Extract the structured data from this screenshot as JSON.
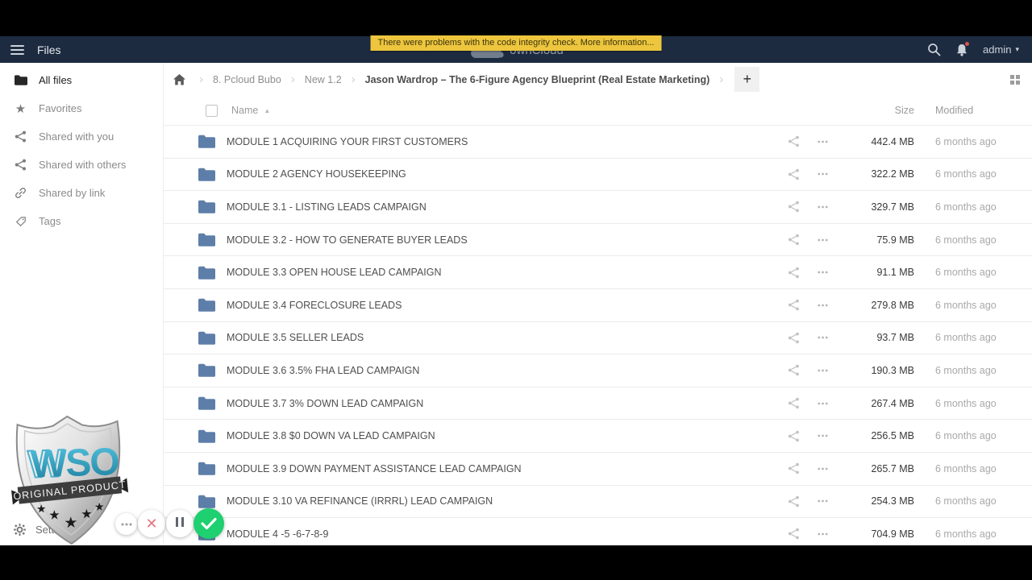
{
  "topbar": {
    "app_label": "Files",
    "logo_text": "ownCloud",
    "banner_text": "There were problems with the code integrity check. More information...",
    "user_label": "admin"
  },
  "sidebar": {
    "items": [
      {
        "label": "All files",
        "icon": "folder-icon",
        "active": true
      },
      {
        "label": "Favorites",
        "icon": "star-icon",
        "active": false
      },
      {
        "label": "Shared with you",
        "icon": "share-icon",
        "active": false
      },
      {
        "label": "Shared with others",
        "icon": "share-icon",
        "active": false
      },
      {
        "label": "Shared by link",
        "icon": "link-icon",
        "active": false
      },
      {
        "label": "Tags",
        "icon": "tag-icon",
        "active": false
      }
    ],
    "settings_label": "Settings"
  },
  "breadcrumb": {
    "crumbs": [
      "8. Pcloud Bubo",
      "New 1.2",
      "Jason Wardrop – The 6-Figure Agency Blueprint (Real Estate Marketing)"
    ],
    "add_button_label": "+"
  },
  "table": {
    "headers": {
      "name": "Name",
      "size": "Size",
      "modified": "Modified"
    },
    "rows": [
      {
        "name": "MODULE 1 ACQUIRING YOUR FIRST CUSTOMERS",
        "size": "442.4 MB",
        "modified": "6 months ago"
      },
      {
        "name": "MODULE 2 AGENCY HOUSEKEEPING",
        "size": "322.2 MB",
        "modified": "6 months ago"
      },
      {
        "name": "MODULE 3.1 - LISTING LEADS CAMPAIGN",
        "size": "329.7 MB",
        "modified": "6 months ago"
      },
      {
        "name": "MODULE 3.2 - HOW TO GENERATE BUYER LEADS",
        "size": "75.9 MB",
        "modified": "6 months ago"
      },
      {
        "name": "MODULE 3.3 OPEN HOUSE LEAD CAMPAIGN",
        "size": "91.1 MB",
        "modified": "6 months ago"
      },
      {
        "name": "MODULE 3.4 FORECLOSURE LEADS",
        "size": "279.8 MB",
        "modified": "6 months ago"
      },
      {
        "name": "MODULE 3.5 SELLER LEADS",
        "size": "93.7 MB",
        "modified": "6 months ago"
      },
      {
        "name": "MODULE 3.6 3.5% FHA LEAD CAMPAIGN",
        "size": "190.3 MB",
        "modified": "6 months ago"
      },
      {
        "name": "MODULE 3.7 3% DOWN LEAD CAMPAIGN",
        "size": "267.4 MB",
        "modified": "6 months ago"
      },
      {
        "name": "MODULE 3.8 $0 DOWN VA LEAD CAMPAIGN",
        "size": "256.5 MB",
        "modified": "6 months ago"
      },
      {
        "name": "MODULE 3.9 DOWN PAYMENT ASSISTANCE LEAD CAMPAIGN",
        "size": "265.7 MB",
        "modified": "6 months ago"
      },
      {
        "name": "MODULE 3.10 VA REFINANCE (IRRRL) LEAD CAMPAIGN",
        "size": "254.3 MB",
        "modified": "6 months ago"
      },
      {
        "name": "MODULE 4 -5 -6-7-8-9",
        "size": "704.9 MB",
        "modified": "6 months ago"
      }
    ]
  },
  "watermark": {
    "title": "WSO",
    "ribbon": "ORIGINAL PRODUCT"
  },
  "colors": {
    "navbar_bg": "#1d2b40",
    "banner_bg": "#edc63e",
    "folder_blue": "#5d7ea8",
    "confirm_green": "#1ed070",
    "cancel_red": "#e5737e"
  }
}
